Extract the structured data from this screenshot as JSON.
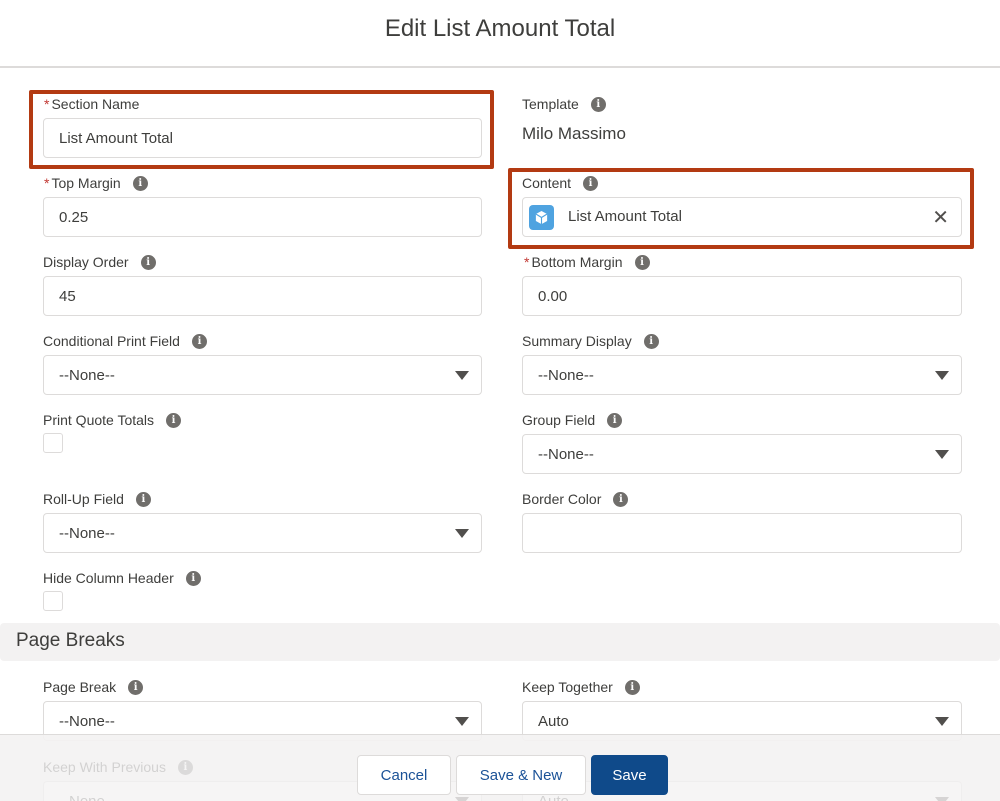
{
  "modal": {
    "title": "Edit List Amount Total"
  },
  "fields": {
    "section_name": {
      "label": "Section Name",
      "required": "*",
      "value": "List Amount Total"
    },
    "template": {
      "label": "Template",
      "value": "Milo Massimo"
    },
    "top_margin": {
      "label": "Top Margin",
      "required": "*",
      "value": "0.25"
    },
    "content": {
      "label": "Content",
      "value": "List Amount Total",
      "icon": "cube-icon"
    },
    "display_order": {
      "label": "Display Order",
      "value": "45"
    },
    "bottom_margin": {
      "label": "Bottom Margin",
      "required": "*",
      "value": "0.00"
    },
    "conditional_print_field": {
      "label": "Conditional Print Field",
      "value": "--None--"
    },
    "summary_display": {
      "label": "Summary Display",
      "value": "--None--"
    },
    "print_quote_totals": {
      "label": "Print Quote Totals",
      "checked": false
    },
    "group_field": {
      "label": "Group Field",
      "value": "--None--"
    },
    "roll_up_field": {
      "label": "Roll-Up Field",
      "value": "--None--"
    },
    "border_color": {
      "label": "Border Color",
      "value": ""
    },
    "hide_column_header": {
      "label": "Hide Column Header",
      "checked": false
    }
  },
  "page_breaks": {
    "heading": "Page Breaks",
    "page_break": {
      "label": "Page Break",
      "value": "--None--"
    },
    "keep_together": {
      "label": "Keep Together",
      "value": "Auto"
    },
    "keep_with_previous": {
      "label": "Keep With Previous",
      "value": "--None--"
    },
    "hidden_right": {
      "value": "Auto"
    }
  },
  "footer": {
    "cancel": "Cancel",
    "save_new": "Save & New",
    "save": "Save"
  },
  "colors": {
    "highlight": "#b33a12",
    "brand": "#0f4a8a",
    "required": "#c23934"
  }
}
